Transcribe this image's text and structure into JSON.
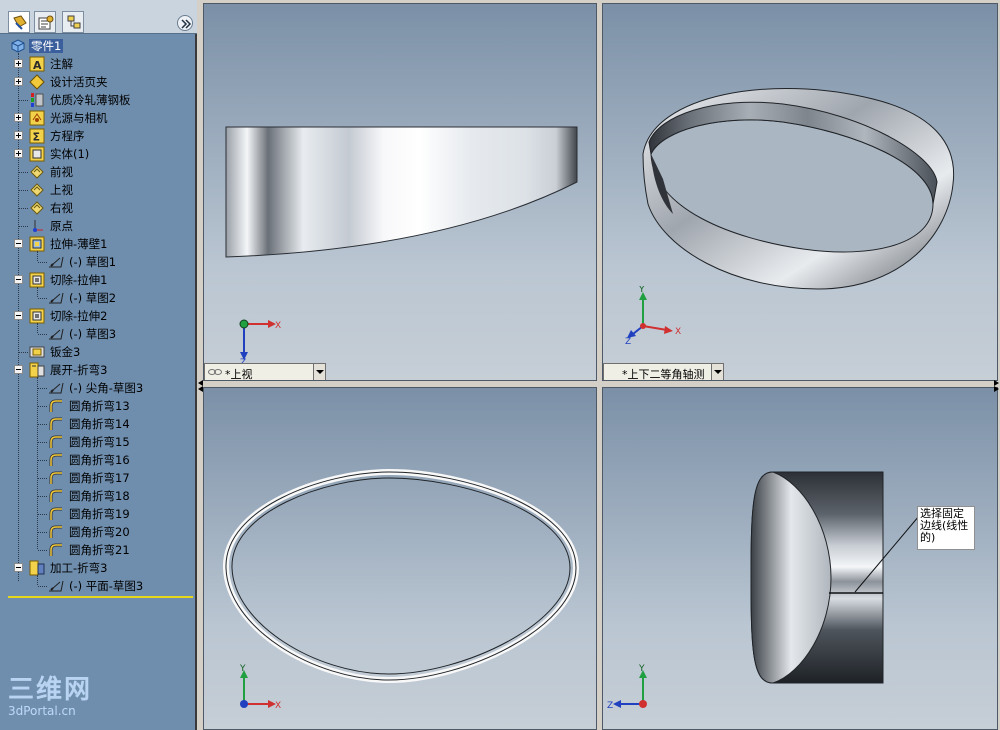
{
  "feature_tree": {
    "root": "零件1",
    "items": [
      {
        "label": "注解",
        "icon": "annotations-icon"
      },
      {
        "label": "设计活页夹",
        "icon": "design-binder-icon"
      },
      {
        "label": "优质冷轧薄钢板",
        "icon": "material-icon"
      },
      {
        "label": "光源与相机",
        "icon": "lights-cameras-icon"
      },
      {
        "label": "方程序",
        "icon": "equations-icon"
      },
      {
        "label": "实体(1)",
        "icon": "solid-bodies-icon"
      },
      {
        "label": "前视",
        "icon": "plane-icon"
      },
      {
        "label": "上视",
        "icon": "plane-icon"
      },
      {
        "label": "右视",
        "icon": "plane-icon"
      },
      {
        "label": "原点",
        "icon": "origin-icon"
      },
      {
        "label": "拉伸-薄壁1",
        "icon": "extrude-thin-icon"
      },
      {
        "label": "(-) 草图1",
        "icon": "sketch-icon"
      },
      {
        "label": "切除-拉伸1",
        "icon": "cut-extrude-icon"
      },
      {
        "label": "(-) 草图2",
        "icon": "sketch-icon"
      },
      {
        "label": "切除-拉伸2",
        "icon": "cut-extrude-icon"
      },
      {
        "label": "(-) 草图3",
        "icon": "sketch-icon"
      },
      {
        "label": "钣金3",
        "icon": "sheet-metal-icon"
      },
      {
        "label": "展开-折弯3",
        "icon": "flatten-bends-icon"
      },
      {
        "label": "(-) 尖角-草图3",
        "icon": "sketch-icon"
      },
      {
        "label": "圆角折弯13",
        "icon": "bend-icon"
      },
      {
        "label": "圆角折弯14",
        "icon": "bend-icon"
      },
      {
        "label": "圆角折弯15",
        "icon": "bend-icon"
      },
      {
        "label": "圆角折弯16",
        "icon": "bend-icon"
      },
      {
        "label": "圆角折弯17",
        "icon": "bend-icon"
      },
      {
        "label": "圆角折弯18",
        "icon": "bend-icon"
      },
      {
        "label": "圆角折弯19",
        "icon": "bend-icon"
      },
      {
        "label": "圆角折弯20",
        "icon": "bend-icon"
      },
      {
        "label": "圆角折弯21",
        "icon": "bend-icon"
      },
      {
        "label": "加工-折弯3",
        "icon": "process-bends-icon"
      },
      {
        "label": "(-) 平面-草图3",
        "icon": "sketch-icon"
      }
    ]
  },
  "viewports": {
    "top": {
      "view_label": "*上视"
    },
    "iso": {
      "view_label": "*上下二等角轴测"
    },
    "front": {},
    "right": {
      "callout": "选择固定边线(线性的)"
    }
  },
  "triad": {
    "x": "X",
    "y": "Y",
    "z": "Z"
  },
  "watermark": {
    "big": "三维网",
    "small": "3dPortal.cn"
  },
  "colors": {
    "tree_bg": "#6f8eae",
    "selection": "#3b5f9c",
    "rollback": "#e7d61a",
    "viewport_top": "#7b90a7",
    "viewport_bottom": "#c6ced6"
  }
}
